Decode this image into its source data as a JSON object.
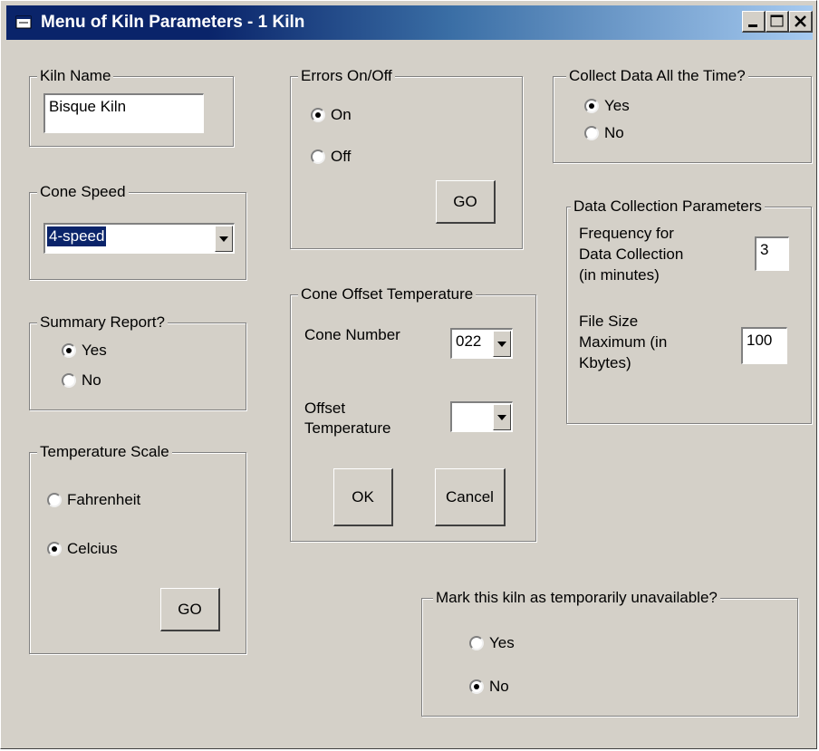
{
  "window": {
    "title": "Menu of Kiln Parameters - 1 Kiln",
    "icon": "app-window-icon",
    "controls": [
      "minimize-icon",
      "maximize-icon",
      "close-icon"
    ]
  },
  "kiln_name": {
    "label": "Kiln Name",
    "value": "Bisque Kiln"
  },
  "cone_speed": {
    "label": "Cone Speed",
    "value": "4-speed"
  },
  "summary_report": {
    "label": "Summary Report?",
    "options": [
      {
        "label": "Yes",
        "checked": true
      },
      {
        "label": "No",
        "checked": false
      }
    ]
  },
  "temperature_scale": {
    "label": "Temperature Scale",
    "options": [
      {
        "label": "Fahrenheit",
        "checked": false
      },
      {
        "label": "Celcius",
        "checked": true
      }
    ],
    "go_label": "GO"
  },
  "errors": {
    "label": "Errors On/Off",
    "options": [
      {
        "label": "On",
        "checked": true
      },
      {
        "label": "Off",
        "checked": false
      }
    ],
    "go_label": "GO"
  },
  "cone_offset": {
    "label": "Cone Offset Temperature",
    "cone_number_label": "Cone Number",
    "cone_number_value": "022",
    "offset_label_line1": "Offset",
    "offset_label_line2": "Temperature",
    "offset_value": "",
    "ok_label": "OK",
    "cancel_label": "Cancel"
  },
  "collect_data": {
    "label": "Collect Data All the Time?",
    "options": [
      {
        "label": "Yes",
        "checked": true
      },
      {
        "label": "No",
        "checked": false
      }
    ]
  },
  "data_collection": {
    "label": "Data Collection Parameters",
    "frequency_label": [
      "Frequency for",
      "Data Collection",
      "(in minutes)"
    ],
    "frequency_value": "3",
    "file_size_label": [
      "File Size",
      "Maximum (in",
      "Kbytes)"
    ],
    "file_size_value": "100"
  },
  "unavailable": {
    "label": "Mark this kiln as temporarily unavailable?",
    "options": [
      {
        "label": "Yes",
        "checked": false
      },
      {
        "label": "No",
        "checked": true
      }
    ]
  },
  "colors": {
    "titlebar_start": "#0a246a",
    "titlebar_end": "#a6caf0",
    "face": "#d4d0c8",
    "selection": "#0a246a"
  }
}
